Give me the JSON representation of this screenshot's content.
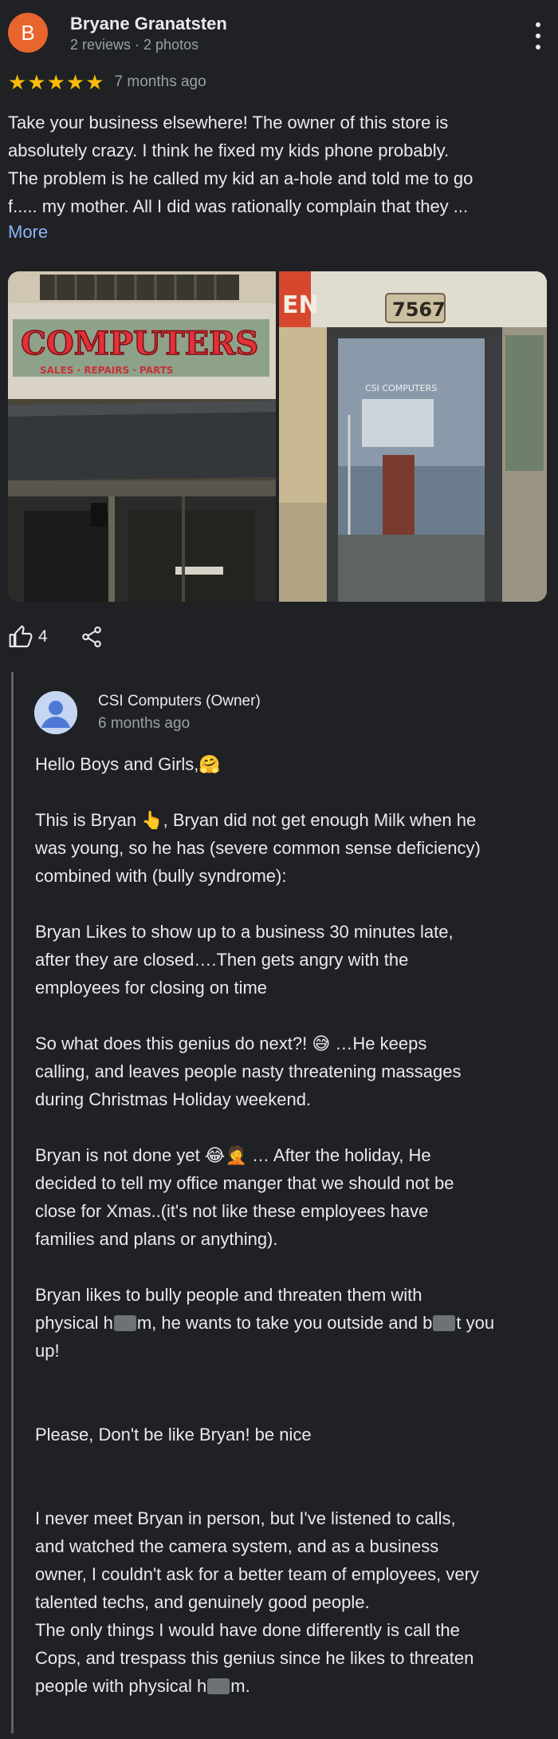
{
  "reviewer": {
    "initial": "B",
    "name": "Bryane Granatsten",
    "meta": "2 reviews · 2 photos",
    "stars": "★★★★★",
    "date": "7 months ago"
  },
  "review": {
    "text_lines": [
      "Take your business elsewhere! The owner of this store is",
      "absolutely crazy. I think he fixed my kids phone probably.",
      "The problem is he called my kid an a-hole and told me to go",
      "f..... my mother. All I did was rationally complain that they ..."
    ],
    "more_label": "More"
  },
  "photos": {
    "left_sign": "COMPUTERS",
    "left_subsign": "SALES · REPAIRS · PARTS",
    "right_number": "7567",
    "right_partial": "EN",
    "right_door_text": "CSI COMPUTERS"
  },
  "actions": {
    "like_count": "4"
  },
  "owner_reply": {
    "name": "CSI Computers (Owner)",
    "date": "6 months ago",
    "p1": "Hello Boys and Girls,🤗",
    "p2_l1": "This is Bryan 👆, Bryan did not get enough Milk when he",
    "p2_l2": "was young, so he has (severe common sense deficiency)",
    "p2_l3": "combined with (bully syndrome):",
    "p3_l1": "Bryan Likes to show up to a business 30 minutes late,",
    "p3_l2": "after they are closed….Then gets angry with the",
    "p3_l3": "employees for closing on time",
    "p4_l1": "So what does this genius do next?! 😅 …He keeps",
    "p4_l2": "calling, and leaves people nasty threatening massages",
    "p4_l3": "during Christmas Holiday weekend.",
    "p5_l1": "Bryan is not done yet 😂🤦 … After the holiday, He",
    "p5_l2": "decided to tell my office manger that we should not be",
    "p5_l3": "close for Xmas..(it's not like these employees have",
    "p5_l4": "families and plans or anything).",
    "p6_l1": "Bryan likes to bully people and threaten them with",
    "p6_l2a": "physical h",
    "p6_l2b": "m, he wants to take you outside and b",
    "p6_l2c": "t you",
    "p6_l3": "up!",
    "p7": "Please, Don't be like Bryan! be nice",
    "p8_l1": "I never meet Bryan in person, but I've listened to calls,",
    "p8_l2": "and watched the camera system, and as a business",
    "p8_l3": "owner, I couldn't ask for a better team of employees, very",
    "p8_l4": "talented techs, and genuinely good people.",
    "p8_l5": "The only things I would have done differently is call the",
    "p8_l6": "Cops, and trespass this genius since he likes to threaten",
    "p8_l7a": "people with physical h",
    "p8_l7b": "m."
  },
  "colors": {
    "background": "#1f2124",
    "text": "#e8eaed",
    "muted": "#9aa0a6",
    "link": "#8ab4f8",
    "star": "#fbbc04",
    "avatar": "#e8652e"
  }
}
